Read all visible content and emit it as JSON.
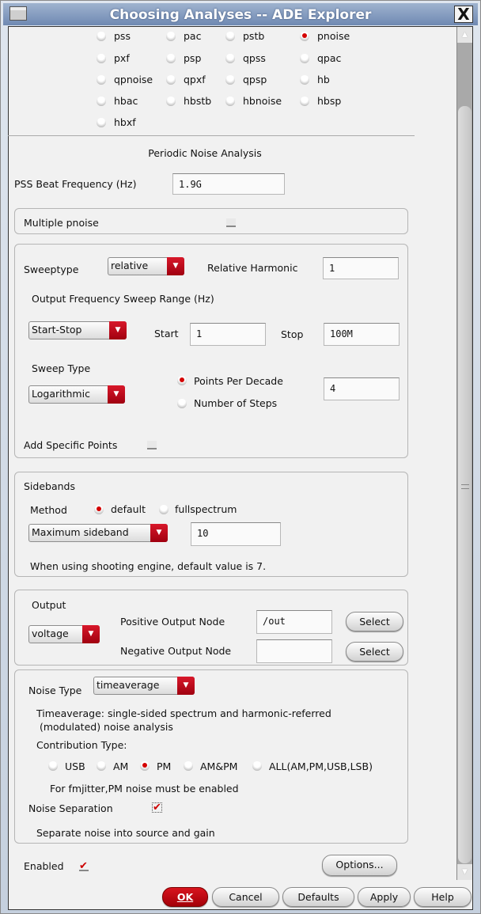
{
  "window": {
    "title": "Choosing Analyses -- ADE Explorer",
    "close": "X"
  },
  "analyses": [
    {
      "label": "pss",
      "selected": false
    },
    {
      "label": "pac",
      "selected": false
    },
    {
      "label": "pstb",
      "selected": false
    },
    {
      "label": "pnoise",
      "selected": true
    },
    {
      "label": "pxf",
      "selected": false
    },
    {
      "label": "psp",
      "selected": false
    },
    {
      "label": "qpss",
      "selected": false
    },
    {
      "label": "qpac",
      "selected": false
    },
    {
      "label": "qpnoise",
      "selected": false
    },
    {
      "label": "qpxf",
      "selected": false
    },
    {
      "label": "qpsp",
      "selected": false
    },
    {
      "label": "hb",
      "selected": false
    },
    {
      "label": "hbac",
      "selected": false
    },
    {
      "label": "hbstb",
      "selected": false
    },
    {
      "label": "hbnoise",
      "selected": false
    },
    {
      "label": "hbsp",
      "selected": false
    },
    {
      "label": "hbxf",
      "selected": false
    }
  ],
  "section_title": "Periodic Noise Analysis",
  "pss_beat": {
    "label": "PSS Beat Frequency (Hz)",
    "value": "1.9G"
  },
  "multiple_pnoise": {
    "label": "Multiple pnoise",
    "checked": false
  },
  "sweep": {
    "sweeptype_label": "Sweeptype",
    "sweeptype_value": "relative",
    "harmonic_label": "Relative Harmonic",
    "harmonic_value": "1",
    "range_label": "Output Frequency Sweep Range (Hz)",
    "range_mode": "Start-Stop",
    "start_label": "Start",
    "start_value": "1",
    "stop_label": "Stop",
    "stop_value": "100M",
    "sweep_type_label": "Sweep Type",
    "sweep_type_value": "Logarithmic",
    "ppd_label": "Points Per Decade",
    "steps_label": "Number of Steps",
    "ppd_value": "4",
    "add_points_label": "Add Specific Points"
  },
  "sidebands": {
    "title": "Sidebands",
    "method_label": "Method",
    "opt_default": "default",
    "opt_full": "fullspectrum",
    "mode": "Maximum sideband",
    "value": "10",
    "note": "When using shooting engine, default value is 7."
  },
  "output": {
    "title": "Output",
    "type": "voltage",
    "pos_label": "Positive Output Node",
    "pos_value": "/out",
    "neg_label": "Negative Output Node",
    "neg_value": "",
    "select": "Select"
  },
  "noise": {
    "type_label": "Noise Type",
    "type_value": "timeaverage",
    "desc1": "Timeaverage: single-sided spectrum and harmonic-referred",
    "desc2": " (modulated) noise analysis",
    "contrib_label": "Contribution Type:",
    "contrib": [
      {
        "label": "USB",
        "selected": false
      },
      {
        "label": "AM",
        "selected": false
      },
      {
        "label": "PM",
        "selected": true
      },
      {
        "label": "AM&PM",
        "selected": false
      },
      {
        "label": "ALL(AM,PM,USB,LSB)",
        "selected": false
      }
    ],
    "fm_note": "For fmjitter,PM noise must be enabled",
    "sep_label": "Noise Separation",
    "sep_note": "Separate noise into source and gain"
  },
  "enabled_label": "Enabled",
  "buttons": {
    "options": "Options...",
    "ok": "OK",
    "cancel": "Cancel",
    "defaults": "Defaults",
    "apply": "Apply",
    "help": "Help"
  }
}
